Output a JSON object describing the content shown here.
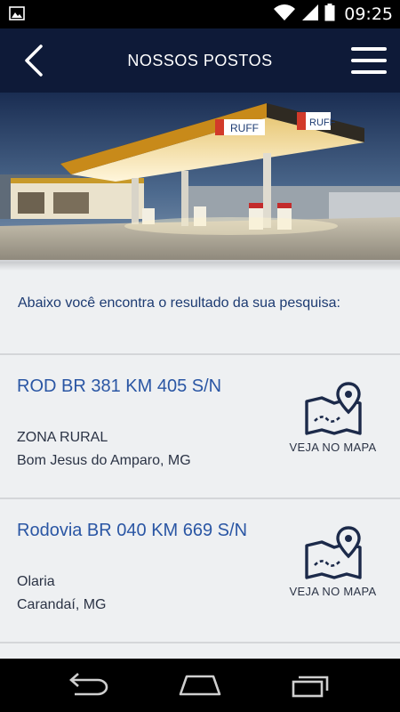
{
  "status_bar": {
    "time": "09:25",
    "icons": [
      "image-notification-icon",
      "wifi-icon",
      "signal-icon",
      "battery-icon"
    ]
  },
  "app_bar": {
    "title": "NOSSOS POSTOS",
    "back_icon": "chevron-left-icon",
    "menu_icon": "hamburger-menu-icon",
    "background": "#0e1a38"
  },
  "hero": {
    "description": "gas station photo",
    "sign_text": "RUFF"
  },
  "search_intro": "Abaixo você encontra o resultado da sua pesquisa:",
  "results": [
    {
      "address": "ROD BR 381 KM 405 S/N",
      "district": "ZONA RURAL",
      "city": "Bom Jesus do Amparo, MG",
      "map_link_label": "VEJA NO MAPA",
      "map_icon": "map-pin-icon"
    },
    {
      "address": "Rodovia BR 040 KM 669 S/N",
      "district": "Olaria",
      "city": "Carandaí, MG",
      "map_link_label": "VEJA NO MAPA",
      "map_icon": "map-pin-icon"
    }
  ],
  "nav_bar": {
    "buttons": [
      "back-icon",
      "home-icon",
      "recents-icon"
    ]
  },
  "colors": {
    "accent_blue": "#2a56a4",
    "dark_navy": "#0e1a38",
    "content_bg": "#eef0f2"
  }
}
